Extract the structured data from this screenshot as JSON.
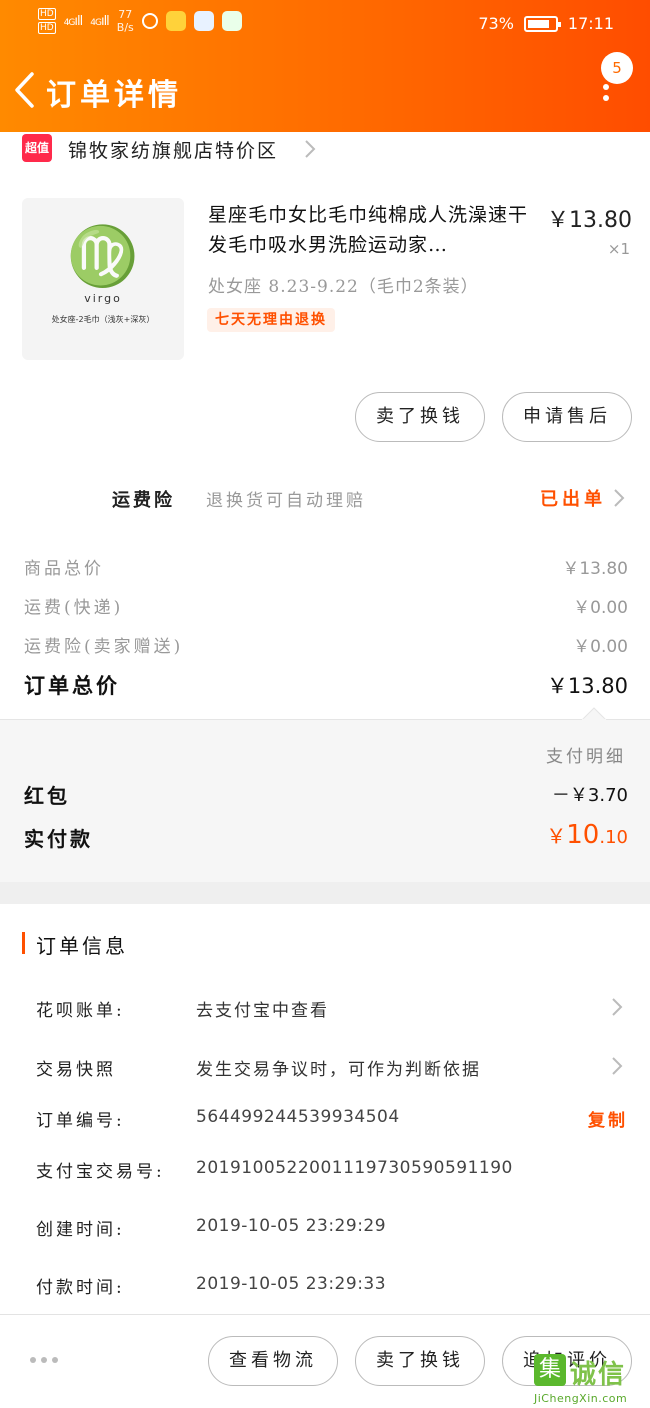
{
  "status_bar": {
    "hd": "HD",
    "network": "4G",
    "signal": "ıll",
    "speed_value": "77",
    "speed_unit": "B/s",
    "battery": "73%",
    "time": "17:11"
  },
  "nav": {
    "title": "订单详情",
    "message_count": "5"
  },
  "shop": {
    "badge": "超值",
    "name": "锦牧家纺旗舰店特价区"
  },
  "product": {
    "image_symbol": "♍",
    "image_word": "virgo",
    "image_caption": "处女座-2毛巾（浅灰+深灰）",
    "title": "星座毛巾女比毛巾纯棉成人洗澡速干发毛巾吸水男洗脸运动家…",
    "price": "￥13.80",
    "quantity": "×1",
    "sku": "处女座 8.23-9.22（毛巾2条装）",
    "tag": "七天无理由退换"
  },
  "product_actions": {
    "sell_exchange": "卖了换钱",
    "after_sale": "申请售后"
  },
  "insurance": {
    "label": "运费险",
    "description": "退换货可自动理赔",
    "status": "已出单"
  },
  "price_rows": [
    {
      "label": "商品总价",
      "value": "￥13.80"
    },
    {
      "label": "运费(快递)",
      "value": "￥0.00"
    },
    {
      "label": "运费险(卖家赠送)",
      "value": "￥0.00"
    }
  ],
  "order_total": {
    "label": "订单总价",
    "value": "￥13.80"
  },
  "payment": {
    "detail_link": "支付明细",
    "red_packet_label": "红包",
    "red_packet_value": "－￥3.70",
    "paid_label": "实付款",
    "paid_currency": "￥",
    "paid_integer": "10",
    "paid_decimal": ".10"
  },
  "order_info": {
    "section_title": "订单信息",
    "huabei_label": "花呗账单:",
    "huabei_value": "去支付宝中查看",
    "snapshot_label": "交易快照",
    "snapshot_value": "发生交易争议时，可作为判断依据",
    "order_no_label": "订单编号:",
    "order_no_value": "564499244539934504",
    "copy_label": "复制",
    "alipay_no_label": "支付宝交易号:",
    "alipay_no_value": "2019100522001119730590591190",
    "created_label": "创建时间:",
    "created_value": "2019-10-05 23:29:29",
    "paid_time_label": "付款时间:",
    "paid_time_value": "2019-10-05 23:29:33"
  },
  "bottom_actions": {
    "logistics": "查看物流",
    "sell_exchange": "卖了换钱",
    "add_review": "追加评价"
  },
  "watermark": {
    "icon": "集",
    "text": "诚信",
    "url": "JiChengXin.com"
  },
  "colors": {
    "brand_orange": "#ff5000",
    "header_gradient_start": "#ff8a00",
    "header_gradient_end": "#ff4d00"
  }
}
